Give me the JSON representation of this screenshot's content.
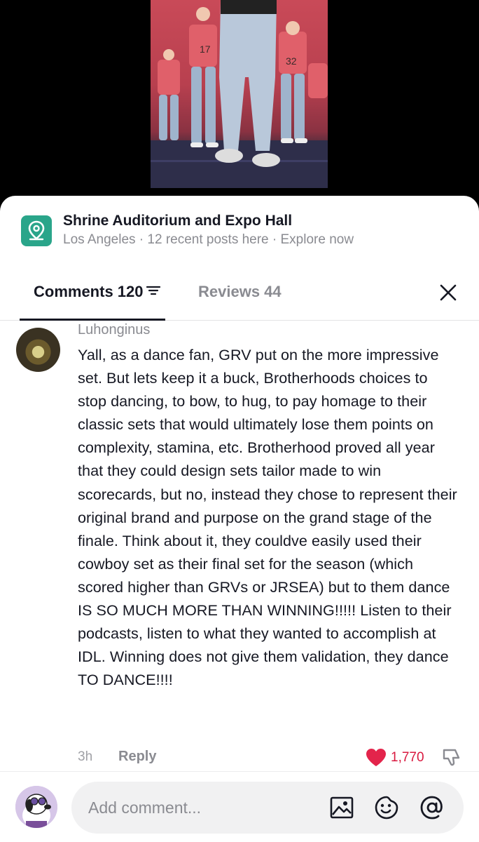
{
  "location": {
    "icon": "map-pin-icon",
    "title": "Shrine Auditorium and Expo Hall",
    "subtitle": "Los Angeles · 12 recent posts here · Explore now"
  },
  "tabs": {
    "comments_label": "Comments 120",
    "reviews_label": "Reviews 44"
  },
  "comment": {
    "username": "Luhonginus",
    "text": "Yall, as a dance fan, GRV put on the more impressive set. But lets keep it a buck, Brotherhoods choices to stop dancing, to bow, to hug, to pay homage to their classic sets that would ultimately lose them points on complexity, stamina, etc. Brotherhood proved all year that they could design sets tailor made to win scorecards, but no, instead they chose to represent their original brand and purpose on the grand stage of the finale. Think about it, they couldve easily used their cowboy set as their final set for the season (which scored higher than GRVs or JRSEA) but to them dance IS SO MUCH MORE THAN WINNING!!!!! Listen to their podcasts, listen to what they wanted to accomplish at IDL. Winning does not give them validation, they dance TO DANCE!!!!",
    "time": "3h",
    "reply_label": "Reply",
    "like_count": "1,770"
  },
  "composer": {
    "placeholder": "Add comment..."
  },
  "colors": {
    "accent_like": "#d9193f",
    "location_icon_bg": "#2aa58a"
  }
}
